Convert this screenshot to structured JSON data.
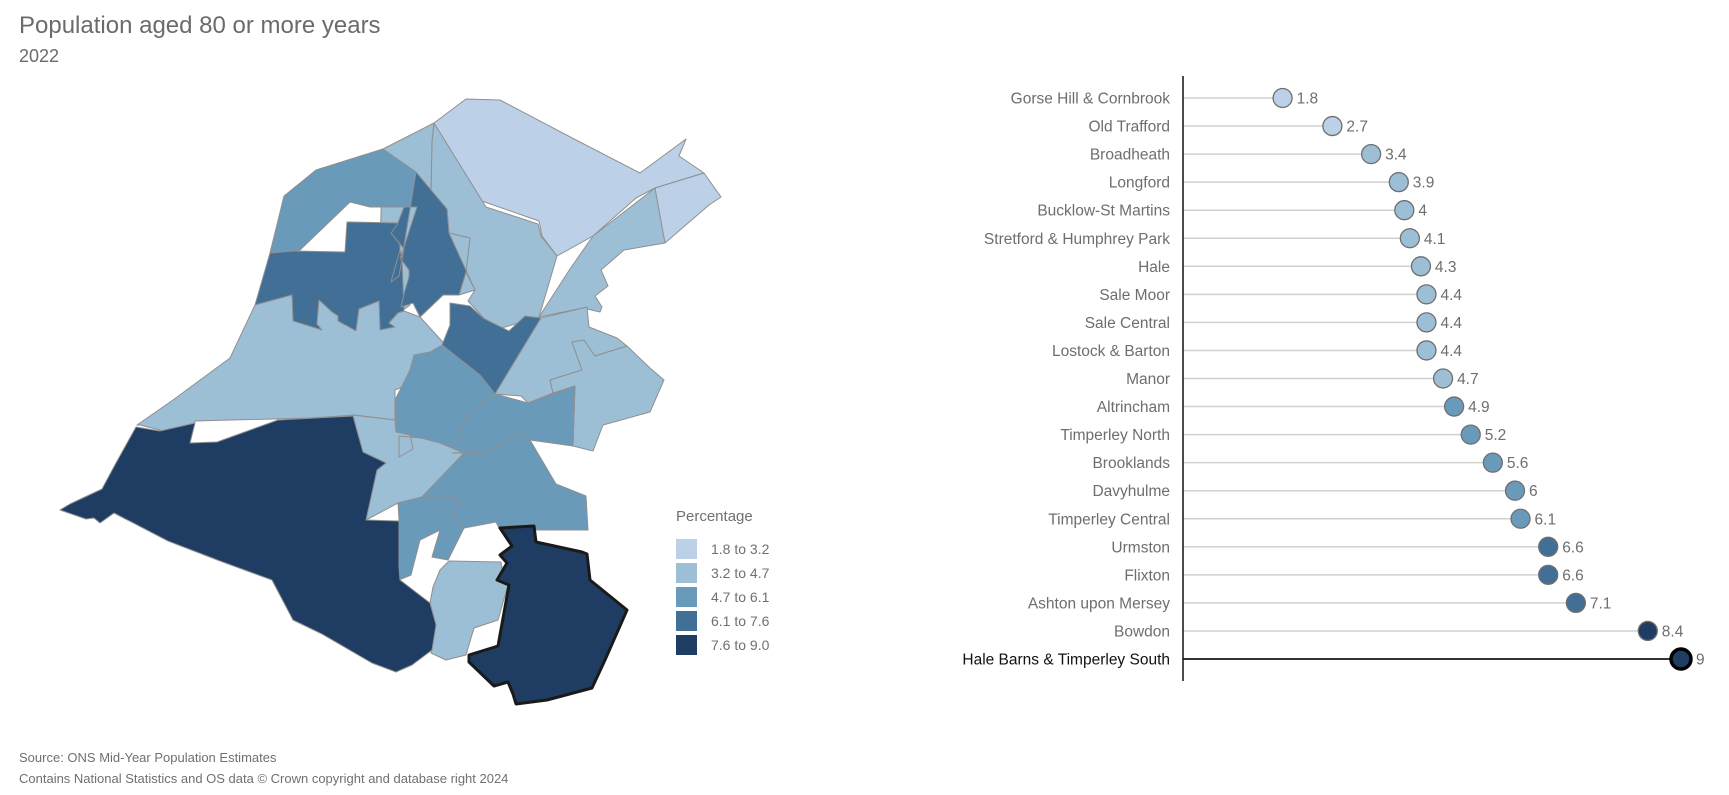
{
  "header": {
    "title": "Population aged 80 or more years",
    "subtitle": "2022"
  },
  "legend": {
    "title": "Percentage",
    "items": [
      {
        "label": "1.8 to 3.2",
        "color": "#bcd1e7"
      },
      {
        "label": "3.2 to 4.7",
        "color": "#9dbfd6"
      },
      {
        "label": "4.7 to 6.1",
        "color": "#6a9aba"
      },
      {
        "label": "6.1 to 7.6",
        "color": "#416f96"
      },
      {
        "label": "7.6 to 9.0",
        "color": "#1f3d63"
      }
    ]
  },
  "footer": {
    "source": "Source: ONS Mid-Year Population Estimates",
    "copyright": "Contains National Statistics and OS data © Crown copyright and database right 2024"
  },
  "chart_data": [
    {
      "type": "choropleth-map",
      "title": "Population aged 80 or more years",
      "subtitle": "2022",
      "legend_title": "Percentage",
      "bins": [
        "1.8 to 3.2",
        "3.2 to 4.7",
        "4.7 to 6.1",
        "6.1 to 7.6",
        "7.6 to 9.0"
      ],
      "highlighted_region": "Hale Barns & Timperley South",
      "legend_position": "bottom-right of map"
    },
    {
      "type": "lollipop",
      "orientation": "horizontal",
      "xlim": [
        0,
        9
      ],
      "highlighted": "Hale Barns & Timperley South",
      "categories": [
        "Gorse Hill & Cornbrook",
        "Old Trafford",
        "Broadheath",
        "Longford",
        "Bucklow-St Martins",
        "Stretford & Humphrey Park",
        "Hale",
        "Sale Moor",
        "Sale Central",
        "Lostock & Barton",
        "Manor",
        "Altrincham",
        "Timperley North",
        "Brooklands",
        "Davyhulme",
        "Timperley Central",
        "Urmston",
        "Flixton",
        "Ashton upon Mersey",
        "Bowdon",
        "Hale Barns & Timperley South"
      ],
      "values": [
        1.8,
        2.7,
        3.4,
        3.9,
        4,
        4.1,
        4.3,
        4.4,
        4.4,
        4.4,
        4.7,
        4.9,
        5.2,
        5.6,
        6,
        6.1,
        6.6,
        6.6,
        7.1,
        8.4,
        9
      ],
      "value_labels": [
        "1.8",
        "2.7",
        "3.4",
        "3.9",
        "4",
        "4.1",
        "4.3",
        "4.4",
        "4.4",
        "4.4",
        "4.7",
        "4.9",
        "5.2",
        "5.6",
        "6",
        "6.1",
        "6.6",
        "6.6",
        "7.1",
        "8.4",
        "9"
      ]
    }
  ]
}
